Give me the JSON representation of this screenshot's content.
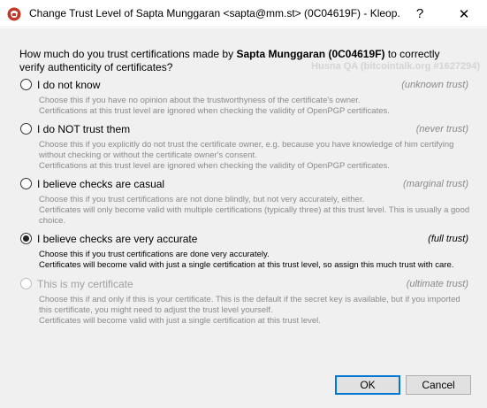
{
  "window": {
    "title": "Change Trust Level of Sapta Munggaran <sapta@mm.st> (0C04619F) - Kleop...",
    "help_glyph": "?",
    "close_glyph": "✕"
  },
  "watermark": "Husna QA (bitcointalk.org #1627294)",
  "question": {
    "prefix": "How much do you trust certifications made by ",
    "name": "Sapta Munggaran (0C04619F)",
    "suffix": " to correctly verify authenticity of certificates?"
  },
  "options": [
    {
      "label": "I do not know",
      "level": "(unknown trust)",
      "checked": false,
      "enabled": true,
      "desc": [
        "Choose this if you have no opinion about the trustworthyness of the certificate's owner.",
        "Certifications at this trust level are ignored when checking the validity of OpenPGP certificates."
      ]
    },
    {
      "label": "I do NOT trust them",
      "level": "(never trust)",
      "checked": false,
      "enabled": true,
      "desc": [
        "Choose this if you explicitly do not trust the certificate owner, e.g. because you have knowledge of him certifying without checking or without the certificate owner's consent.",
        "Certifications at this trust level are ignored when checking the validity of OpenPGP certificates."
      ]
    },
    {
      "label": "I believe checks are casual",
      "level": "(marginal trust)",
      "checked": false,
      "enabled": true,
      "desc": [
        "Choose this if you trust certifications are not done blindly, but not very accurately, either.",
        "Certificates will only become valid with multiple certifications (typically three) at this trust level. This is usually a good choice."
      ]
    },
    {
      "label": "I believe checks are very accurate",
      "level": "(full trust)",
      "checked": true,
      "enabled": true,
      "desc": [
        "Choose this if you trust certifications are done very accurately.",
        "Certificates will become valid with just a single certification at this trust level, so assign this much trust with care."
      ]
    },
    {
      "label": "This is my certificate",
      "level": "(ultimate trust)",
      "checked": false,
      "enabled": false,
      "desc": [
        "Choose this if and only if this is your certificate. This is the default if the secret key is available, but if you imported this certificate, you might need to adjust the trust level yourself.",
        "Certificates will become valid with just a single certification at this trust level."
      ]
    }
  ],
  "buttons": {
    "ok": "OK",
    "cancel": "Cancel"
  },
  "colors": {
    "accent": "#0078d7",
    "dialog_bg": "#f0f0f0",
    "app_icon": "#c0392b"
  },
  "icons": {
    "app": "kleopatra-app-icon"
  }
}
